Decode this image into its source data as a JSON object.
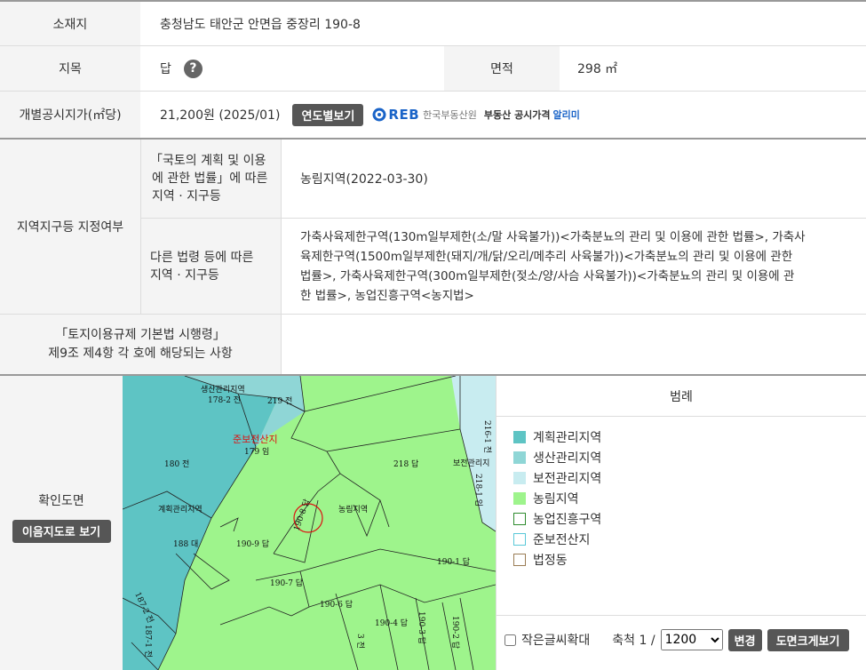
{
  "info": {
    "location_label": "소재지",
    "location_value": "충청남도 태안군 안면읍 중장리 190-8",
    "jimok_label": "지목",
    "jimok_value": "답",
    "help_icon_text": "?",
    "area_label": "면적",
    "area_value": "298 ㎡",
    "price_label": "개별공시지가(㎡당)",
    "price_value": "21,200원 (2025/01)",
    "yearly_button": "연도별보기",
    "reb_logo_text": "REB",
    "reb_org": "한국부동산원",
    "reb_service_prefix": "부동산 공시가격",
    "reb_service_suffix": "알리미"
  },
  "zoning": {
    "label": "지역지구등 지정여부",
    "row1_label_line1": "「국토의 계획 및 이용",
    "row1_label_line2": "에 관한 법률」에 따른",
    "row1_label_line3": "지역 · 지구등",
    "row1_value": "농림지역(2022-03-30)",
    "row2_label_line1": "다른 법령 등에 따른",
    "row2_label_line2": "지역 · 지구등",
    "row2_value_line1": "가축사육제한구역(130m일부제한(소/말 사육불가))<가축분뇨의 관리 및 이용에 관한 법률>, 가축사",
    "row2_value_line2": "육제한구역(1500m일부제한(돼지/개/닭/오리/메추리 사육불가))<가축분뇨의 관리 및 이용에 관한",
    "row2_value_line3": "법률>, 가축사육제한구역(300m일부제한(젖소/양/사슴 사육불가))<가축분뇨의 관리 및 이용에 관",
    "row2_value_line4": "한 법률>, 농업진흥구역<농지법>"
  },
  "regulation": {
    "label_line1": "「토지이용규제 기본법 시행령」",
    "label_line2": "제9조 제4항 각 호에 해당되는 사항",
    "value": ""
  },
  "map_section": {
    "label": "확인도면",
    "view_button": "이음지도로 보기",
    "map_labels": {
      "l1": "생산관리지역",
      "l2": "178-2 전",
      "l3": "219 전",
      "l4": "준보전산지",
      "l5": "179 임",
      "l6": "180 전",
      "l7": "218 답",
      "l8": "보전관리지",
      "l9": "216-1 전",
      "l10": "218-1 임",
      "l11": "계획관리지역",
      "l12": "농림지역",
      "l13": "190-8 답",
      "l14": "188 대",
      "l15": "190-9 답",
      "l16": "190-1 답",
      "l17": "190-7 답",
      "l18": "190-6 답",
      "l19": "190-4 답",
      "l20": "190-3 답",
      "l21": "190-2 답",
      "l22": "187-2 전",
      "l23": "187-1 전",
      "l24": "3 전"
    }
  },
  "legend": {
    "title": "범례",
    "items": [
      {
        "label": "계획관리지역",
        "color": "#5ec4c4",
        "border": "#5ec4c4"
      },
      {
        "label": "생산관리지역",
        "color": "#8fd6d6",
        "border": "#8fd6d6"
      },
      {
        "label": "보전관리지역",
        "color": "#c8ecf0",
        "border": "#c8ecf0"
      },
      {
        "label": "농림지역",
        "color": "#9ef48c",
        "border": "#9ef48c"
      },
      {
        "label": "농업진흥구역",
        "color": "#ffffff",
        "border": "#2e8b2e"
      },
      {
        "label": "준보전산지",
        "color": "#ffffff",
        "border": "#5ac8d8"
      },
      {
        "label": "법정동",
        "color": "#ffffff",
        "border": "#9a7c55"
      }
    ]
  },
  "controls": {
    "small_text_label": "작은글씨확대",
    "scale_label": "축척 1 /",
    "scale_value": "1200",
    "change_button": "변경",
    "enlarge_button": "도면크게보기"
  }
}
